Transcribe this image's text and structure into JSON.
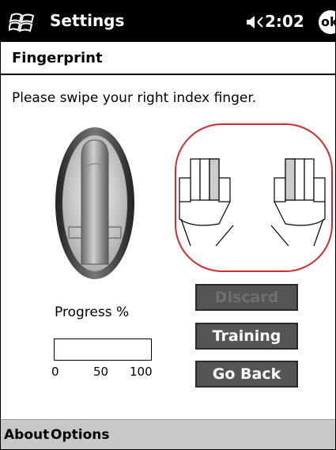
{
  "titlebar": {
    "title": "Settings",
    "time": "2:02",
    "ok_label": "ok",
    "start_icon": "windows-flag-icon",
    "volume_icon": "speaker-icon"
  },
  "page": {
    "title": "Fingerprint",
    "instruction": "Please swipe your right index finger."
  },
  "sensor": {
    "icon": "finger-sensor-icon"
  },
  "hands": {
    "icons": [
      "left-hand-icon",
      "right-hand-icon"
    ],
    "highlight_color": "#d42a2a"
  },
  "progress": {
    "label": "Progress %",
    "value_percent": 0,
    "ticks": [
      "0",
      "50",
      "100"
    ]
  },
  "buttons": {
    "discard": "Discard",
    "training": "Training",
    "go_back": "Go Back"
  },
  "menubar": {
    "about": "About",
    "options": "Options"
  }
}
